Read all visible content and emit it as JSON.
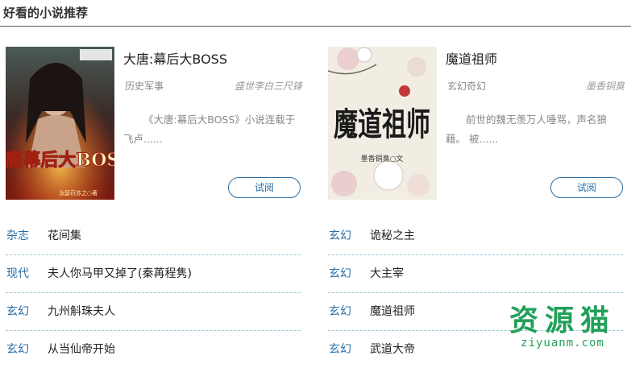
{
  "header": {
    "title": "好看的小说推荐"
  },
  "featured": [
    {
      "title": "大唐:幕后大BOSS",
      "genre": "历史军事",
      "author": "盛世李白三尺锋",
      "description": "《大唐:幕后大BOSS》小说连载于飞卢......",
      "button": "试阅",
      "cover_text": "大唐幕后大BOSS",
      "cover_sub": "汝瑟苻苏之○著"
    },
    {
      "title": "魔道祖师",
      "genre": "玄幻奇幻",
      "author": "墨香铜臭",
      "description": "前世的魏无羡万人唾骂，声名狼藉。 被......",
      "button": "试阅",
      "cover_text": "魔道祖师",
      "cover_sub": "墨香铜臭○文"
    }
  ],
  "list_left": [
    {
      "category": "杂志",
      "name": "花间集"
    },
    {
      "category": "现代",
      "name": "夫人你马甲又掉了(秦苒程隽)"
    },
    {
      "category": "玄幻",
      "name": "九州斛珠夫人"
    },
    {
      "category": "玄幻",
      "name": "从当仙帝开始"
    }
  ],
  "list_right": [
    {
      "category": "玄幻",
      "name": "诡秘之主"
    },
    {
      "category": "玄幻",
      "name": "大主宰"
    },
    {
      "category": "玄幻",
      "name": "魔道祖师"
    },
    {
      "category": "玄幻",
      "name": "武道大帝"
    }
  ],
  "watermark": {
    "main": "资源猫",
    "sub": "ziyuanm.com"
  },
  "colors": {
    "accent": "#2a6ea6",
    "watermark": "#22a05a",
    "divider": "#9fc8d6"
  }
}
